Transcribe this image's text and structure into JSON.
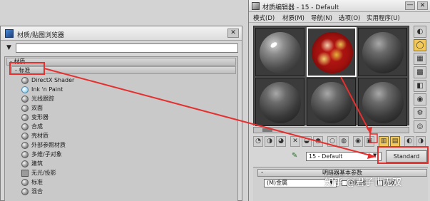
{
  "colors": {
    "annotation": "#e53030",
    "window_bg": "#d6d6d6",
    "slot_bg": "#3b3b3b",
    "active_tool": "#f2c85a"
  },
  "browser": {
    "title": "材质/贴图浏览器",
    "close_label": "✕",
    "filter_icon": "filter-icon",
    "search_value": "",
    "group_material": "- 材质",
    "group_standard": "- 标准",
    "items": [
      {
        "label": "DirectX Shader",
        "icon": "sphere"
      },
      {
        "label": "Ink 'n Paint",
        "icon": "sphere-light-blue"
      },
      {
        "label": "光线跟踪",
        "icon": "sphere"
      },
      {
        "label": "双面",
        "icon": "sphere"
      },
      {
        "label": "变形器",
        "icon": "sphere"
      },
      {
        "label": "合成",
        "icon": "sphere"
      },
      {
        "label": "壳材质",
        "icon": "sphere"
      },
      {
        "label": "外部参照材质",
        "icon": "sphere"
      },
      {
        "label": "多维/子对象",
        "icon": "sphere"
      },
      {
        "label": "建筑",
        "icon": "sphere"
      },
      {
        "label": "无光/投影",
        "icon": "square"
      },
      {
        "label": "标准",
        "icon": "sphere"
      },
      {
        "label": "混合",
        "icon": "sphere"
      }
    ]
  },
  "editor": {
    "title": "材质编辑器 - 15 - Default",
    "min_label": "—",
    "close_label": "✕",
    "menu": [
      "模式(D)",
      "材质(M)",
      "导航(N)",
      "选项(O)",
      "实用程序(U)"
    ],
    "material_name": "15 - Default",
    "standard_label": "Standard",
    "rollout_title": "明暗器基本参数",
    "rollout_toggle": "-",
    "shader": "(M)金属",
    "checkbox_faceted": "面贴图",
    "checkbox_wire": "面状"
  },
  "watermark": "知乎 @君子世无双"
}
